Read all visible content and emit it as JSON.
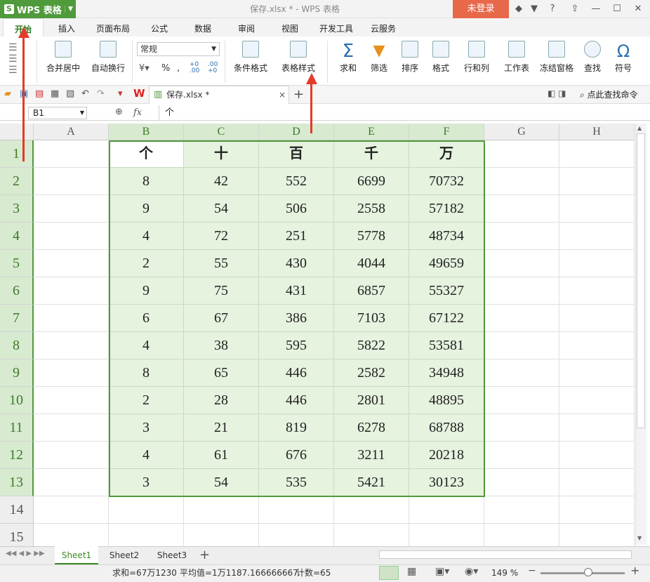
{
  "titlebar": {
    "app_label": "WPS 表格",
    "doc_title": "保存.xlsx * - WPS 表格",
    "login_label": "未登录"
  },
  "tabs": [
    "开始",
    "插入",
    "页面布局",
    "公式",
    "数据",
    "审阅",
    "视图",
    "开发工具",
    "云服务"
  ],
  "active_tab": "开始",
  "ribbon": {
    "merge_center": "合并居中",
    "wrap_text": "自动换行",
    "number_format": "常规",
    "conditional_format": "条件格式",
    "table_style": "表格样式",
    "sum": "求和",
    "filter": "筛选",
    "sort": "排序",
    "format": "格式",
    "row_col": "行和列",
    "worksheet": "工作表",
    "freeze": "冻结窗格",
    "find": "查找",
    "symbol": "符号",
    "percent": "%"
  },
  "doc_tab": {
    "name": "保存.xlsx *",
    "find_cmd": "点此查找命令"
  },
  "formula_bar": {
    "name_box": "B1",
    "fx": "fx",
    "content": "个"
  },
  "columns": [
    "A",
    "B",
    "C",
    "D",
    "E",
    "F",
    "G",
    "H"
  ],
  "rows": [
    "1",
    "2",
    "3",
    "4",
    "5",
    "6",
    "7",
    "8",
    "9",
    "10",
    "11",
    "12",
    "13",
    "14",
    "15"
  ],
  "table": {
    "headers": [
      "个",
      "十",
      "百",
      "千",
      "万"
    ],
    "rows": [
      [
        "8",
        "42",
        "552",
        "6699",
        "70732"
      ],
      [
        "9",
        "54",
        "506",
        "2558",
        "57182"
      ],
      [
        "4",
        "72",
        "251",
        "5778",
        "48734"
      ],
      [
        "2",
        "55",
        "430",
        "4044",
        "49659"
      ],
      [
        "9",
        "75",
        "431",
        "6857",
        "55327"
      ],
      [
        "6",
        "67",
        "386",
        "7103",
        "67122"
      ],
      [
        "4",
        "38",
        "595",
        "5822",
        "53581"
      ],
      [
        "8",
        "65",
        "446",
        "2582",
        "34948"
      ],
      [
        "2",
        "28",
        "446",
        "2801",
        "48895"
      ],
      [
        "3",
        "21",
        "819",
        "6278",
        "68788"
      ],
      [
        "4",
        "61",
        "676",
        "3211",
        "20218"
      ],
      [
        "3",
        "54",
        "535",
        "5421",
        "30123"
      ]
    ]
  },
  "sheets": [
    "Sheet1",
    "Sheet2",
    "Sheet3"
  ],
  "active_sheet": "Sheet1",
  "status": {
    "sum": "求和=67万1230",
    "average": "平均值=1万1187.166666667",
    "count": "计数=65",
    "zoom": "149 %"
  },
  "colors": {
    "accent": "#4f9a3b",
    "selection_fill": "#e6f3df",
    "login": "#e8684a",
    "annotation_arrow": "#e53a2a"
  }
}
